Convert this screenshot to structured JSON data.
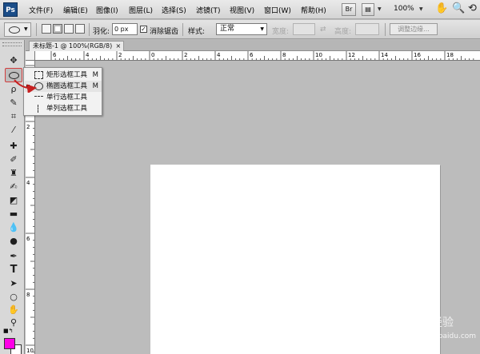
{
  "app": {
    "logo": "Ps"
  },
  "menubar": {
    "items": [
      "文件(F)",
      "编辑(E)",
      "图像(I)",
      "图层(L)",
      "选择(S)",
      "滤镜(T)",
      "视图(V)",
      "窗口(W)",
      "帮助(H)"
    ],
    "bridge_label": "Br",
    "zoom": "100%"
  },
  "options": {
    "feather_label": "羽化:",
    "feather_value": "0 px",
    "antialias_label": "消除锯齿",
    "antialias_checked": true,
    "style_label": "样式:",
    "style_value": "正常",
    "width_label": "宽度:",
    "height_label": "高度:",
    "refine_edge_label": "调整边缘..."
  },
  "document": {
    "tab_title": "未标题-1 @ 100%(RGB/8)",
    "close": "×"
  },
  "ruler": {
    "h_labels": [
      "6",
      "4",
      "2",
      "0",
      "2",
      "4",
      "6",
      "8",
      "10",
      "12",
      "14",
      "16",
      "18"
    ],
    "v_labels": [
      "0",
      "2",
      "4",
      "6",
      "8",
      "10"
    ]
  },
  "flyout": {
    "items": [
      {
        "label": "矩形选框工具",
        "shortcut": "M"
      },
      {
        "label": "椭圆选框工具",
        "shortcut": "M"
      },
      {
        "label": "单行选框工具",
        "shortcut": ""
      },
      {
        "label": "单列选框工具",
        "shortcut": ""
      }
    ]
  },
  "colors": {
    "foreground": "#ff00e6",
    "background": "#ffffff",
    "highlight": "#d23c3c"
  },
  "watermark": {
    "text": "Bai",
    "sub": "经验",
    "url": "jingyan.baidu.com"
  }
}
